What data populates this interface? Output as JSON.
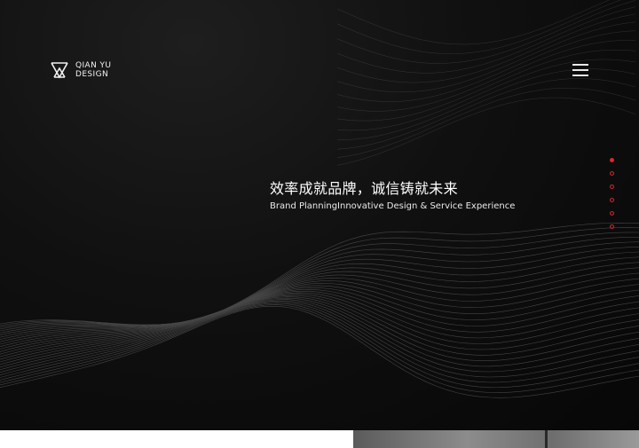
{
  "brand": {
    "name_line1": "QIAN YU",
    "name_line2": "DESIGN",
    "logo_icon": "qianyu-logo-mark"
  },
  "header": {
    "menu_icon": "hamburger-menu-icon"
  },
  "hero": {
    "title_cn": "效率成就品牌，诚信铸就未来",
    "subtitle_en": "Brand PlanningInnovative Design & Service Experience"
  },
  "pager": {
    "count": 6,
    "active_index": 0,
    "accent_color": "#e0282f"
  },
  "colors": {
    "background": "#0b0b0b",
    "text": "#ffffff",
    "accent": "#e0282f"
  }
}
